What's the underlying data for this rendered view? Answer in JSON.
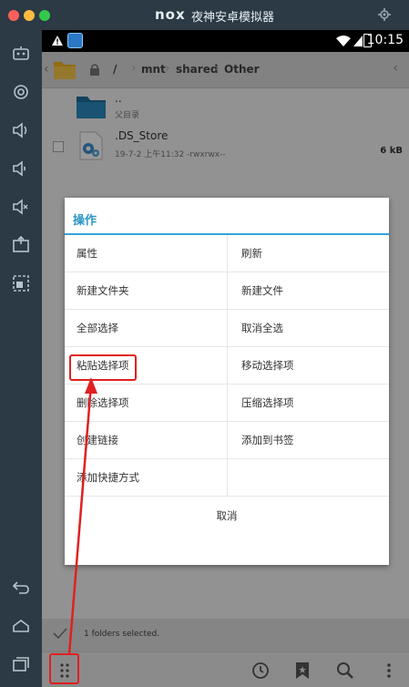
{
  "emulator": {
    "brand": "nox",
    "title": "夜神安卓模拟器",
    "colors": {
      "titlebar": "#2c3a45",
      "close": "#fc605c",
      "minimize": "#fdbc40",
      "maximize": "#34c84a"
    },
    "left_toolbar": [
      "robot-icon",
      "location-icon",
      "volume-up-icon",
      "volume-down-icon",
      "mute-icon",
      "screenshot-icon",
      "multi-window-icon",
      "back-icon",
      "home-icon",
      "recent-apps-icon"
    ]
  },
  "statusbar": {
    "time": "10:15"
  },
  "path": {
    "root": "/",
    "segments": [
      "mnt",
      "shared",
      "Other"
    ]
  },
  "files": [
    {
      "name": "..",
      "sub": "父目录"
    },
    {
      "name": ".DS_Store",
      "sub": "19-7-2 上午11:32 -rwxrwx--",
      "size": "6 kB"
    }
  ],
  "dialog": {
    "title": "操作",
    "items": [
      [
        "属性",
        "刷新"
      ],
      [
        "新建文件夹",
        "新建文件"
      ],
      [
        "全部选择",
        "取消全选"
      ],
      [
        "粘贴选择项",
        "移动选择项"
      ],
      [
        "删除选择项",
        "压缩选择项"
      ],
      [
        "创建链接",
        "添加到书签"
      ],
      [
        "添加快捷方式",
        ""
      ]
    ],
    "cancel": "取消"
  },
  "selection": {
    "status": "1 folders selected."
  },
  "bottom_bar": [
    "menu-icon",
    "history-icon",
    "bookmark-icon",
    "search-icon",
    "overflow-icon"
  ]
}
